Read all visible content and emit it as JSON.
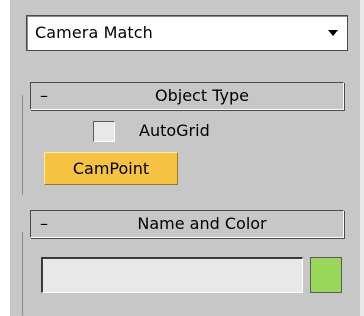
{
  "dropdown": {
    "selected": "Camera Match"
  },
  "rollouts": [
    {
      "collapse_symbol": "–",
      "title": "Object Type",
      "autogrid": {
        "label": "AutoGrid",
        "checked": false
      },
      "buttons": [
        {
          "label": "CamPoint",
          "active": true
        }
      ]
    },
    {
      "collapse_symbol": "–",
      "title": "Name and Color",
      "name_value": "",
      "swatch_color": "#99d75a"
    }
  ],
  "colors": {
    "panel_bg": "#c7c7c7",
    "active_button": "#f5c242",
    "field_bg": "#e8e8e8",
    "swatch": "#99d75a"
  }
}
